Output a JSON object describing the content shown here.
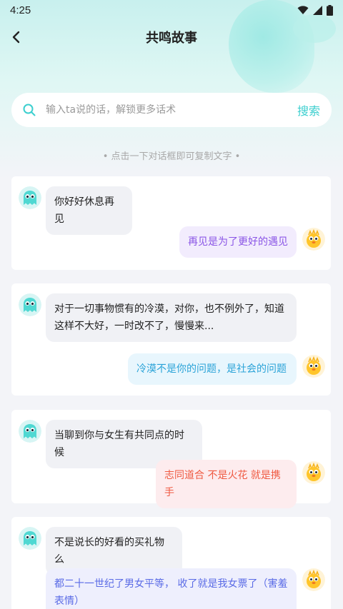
{
  "status_bar": {
    "time": "4:25",
    "icons": [
      "wifi-icon",
      "signal-icon",
      "battery-icon"
    ]
  },
  "header": {
    "title": "共鸣故事",
    "back_icon": "back-arrow-icon"
  },
  "search": {
    "placeholder": "输入ta说的话，解锁更多话术",
    "button_label": "搜索"
  },
  "hint": "• 点击一下对话框即可复制文字 •",
  "colors": {
    "accent": "#3ccfcf",
    "purple": "#8a55e6",
    "blue": "#2aa3d8",
    "red": "#ef5a42",
    "indigo": "#5a6be6"
  },
  "conversations": [
    {
      "left": "你好好休息再见",
      "right": "再见是为了更好的遇见",
      "right_color": "purple"
    },
    {
      "left": "对于一切事物惯有的冷漠，对你，也不例外了，知道这样不大好，一时改不了，慢慢来...",
      "right": "冷漠不是你的问题，是社会的问题",
      "right_color": "blue"
    },
    {
      "left": "当聊到你与女生有共同点的时候",
      "right": "志同道合 不是火花 就是携手",
      "right_color": "red"
    },
    {
      "left": "不是说长的好看的买礼物么",
      "right": "都二十一世纪了男女平等， 收了就是我女票了（害羞表情）",
      "right_color": "indigo"
    }
  ]
}
